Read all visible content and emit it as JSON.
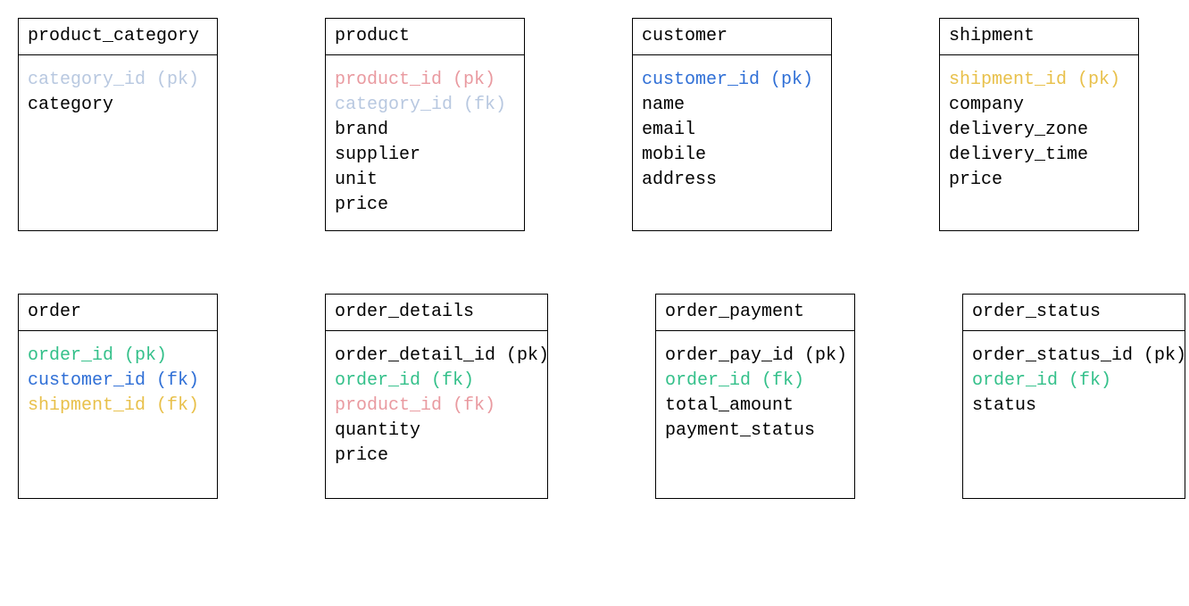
{
  "colors": {
    "category_id": "#b8c8e0",
    "product_id": "#e99aa0",
    "customer_id": "#2f6fd6",
    "shipment_id": "#e8c04a",
    "order_id": "#34c08a",
    "default": "#000000"
  },
  "layout": {
    "rows": 2,
    "cols": 4,
    "box_min_height_row1": 230,
    "box_min_height_row2": 230
  },
  "tables": [
    {
      "name": "product_category",
      "fields": [
        {
          "name": "category_id",
          "key": "(pk)",
          "colorKey": "category_id"
        },
        {
          "name": "category",
          "key": "",
          "colorKey": "default"
        }
      ]
    },
    {
      "name": "product",
      "fields": [
        {
          "name": "product_id",
          "key": "(pk)",
          "colorKey": "product_id"
        },
        {
          "name": "category_id",
          "key": "(fk)",
          "colorKey": "category_id"
        },
        {
          "name": "brand",
          "key": "",
          "colorKey": "default"
        },
        {
          "name": "supplier",
          "key": "",
          "colorKey": "default"
        },
        {
          "name": "unit",
          "key": "",
          "colorKey": "default"
        },
        {
          "name": "price",
          "key": "",
          "colorKey": "default"
        }
      ]
    },
    {
      "name": "customer",
      "fields": [
        {
          "name": "customer_id",
          "key": "(pk)",
          "colorKey": "customer_id"
        },
        {
          "name": "name",
          "key": "",
          "colorKey": "default"
        },
        {
          "name": "email",
          "key": "",
          "colorKey": "default"
        },
        {
          "name": "mobile",
          "key": "",
          "colorKey": "default"
        },
        {
          "name": "address",
          "key": "",
          "colorKey": "default"
        }
      ]
    },
    {
      "name": "shipment",
      "fields": [
        {
          "name": "shipment_id",
          "key": "(pk)",
          "colorKey": "shipment_id"
        },
        {
          "name": "company",
          "key": "",
          "colorKey": "default"
        },
        {
          "name": "delivery_zone",
          "key": "",
          "colorKey": "default"
        },
        {
          "name": "delivery_time",
          "key": "",
          "colorKey": "default"
        },
        {
          "name": "price",
          "key": "",
          "colorKey": "default"
        }
      ]
    },
    {
      "name": "order",
      "fields": [
        {
          "name": "order_id",
          "key": "(pk)",
          "colorKey": "order_id"
        },
        {
          "name": "customer_id",
          "key": "(fk)",
          "colorKey": "customer_id"
        },
        {
          "name": "shipment_id",
          "key": "(fk)",
          "colorKey": "shipment_id"
        }
      ]
    },
    {
      "name": "order_details",
      "fields": [
        {
          "name": "order_detail_id",
          "key": "(pk)",
          "colorKey": "default"
        },
        {
          "name": "order_id",
          "key": "(fk)",
          "colorKey": "order_id"
        },
        {
          "name": "product_id",
          "key": "(fk)",
          "colorKey": "product_id"
        },
        {
          "name": "quantity",
          "key": "",
          "colorKey": "default"
        },
        {
          "name": "price",
          "key": "",
          "colorKey": "default"
        }
      ]
    },
    {
      "name": "order_payment",
      "fields": [
        {
          "name": "order_pay_id",
          "key": "(pk)",
          "colorKey": "default"
        },
        {
          "name": "order_id",
          "key": "(fk)",
          "colorKey": "order_id"
        },
        {
          "name": "total_amount",
          "key": "",
          "colorKey": "default"
        },
        {
          "name": "payment_status",
          "key": "",
          "colorKey": "default"
        }
      ]
    },
    {
      "name": "order_status",
      "fields": [
        {
          "name": "order_status_id",
          "key": "(pk)",
          "colorKey": "default"
        },
        {
          "name": "order_id",
          "key": "(fk)",
          "colorKey": "order_id"
        },
        {
          "name": "status",
          "key": "",
          "colorKey": "default"
        }
      ]
    }
  ]
}
